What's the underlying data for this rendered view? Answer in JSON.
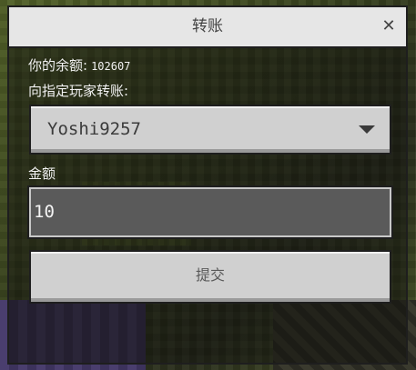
{
  "dialog": {
    "title": "转账",
    "close_icon": "close-icon"
  },
  "balance": {
    "label": "你的余额:",
    "value": "102607"
  },
  "transfer": {
    "to_label": "向指定玩家转账:",
    "selected_player": "Yoshi9257",
    "amount_label": "金额",
    "amount_value": "10",
    "submit_label": "提交"
  }
}
